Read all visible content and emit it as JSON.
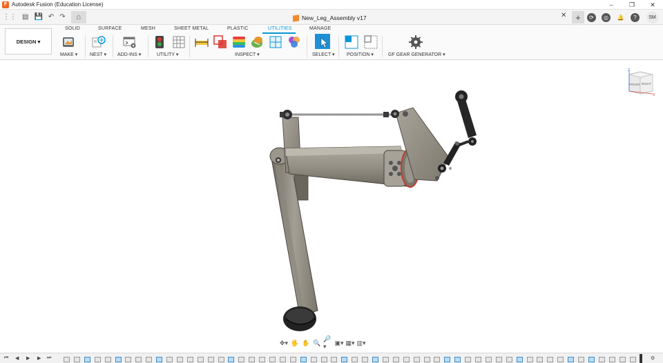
{
  "titlebar": {
    "logo_letter": "F",
    "title": "Autodesk Fusion (Education License)",
    "minimize": "–",
    "restore": "❐",
    "close": "✕"
  },
  "qat": {
    "grid_icon": "⋮⋮",
    "file_icon": "▤",
    "save_icon": "💾",
    "undo_icon": "↶",
    "redo_icon": "↷",
    "home_icon": "⌂"
  },
  "document": {
    "name": "New_Leg_Assembly v17",
    "close_icon": "✕",
    "new_tab_icon": "+"
  },
  "user": {
    "initials": "SM",
    "job_status_icon": "⟳",
    "extensions_icon": "◎",
    "notifications_icon": "🔔",
    "help_icon": "?"
  },
  "ribbon": {
    "workspace": "DESIGN ▾",
    "tabs": [
      "SOLID",
      "SURFACE",
      "MESH",
      "SHEET METAL",
      "PLASTIC",
      "UTILITIES",
      "MANAGE"
    ],
    "active_tab": "UTILITIES",
    "groups": {
      "make": "MAKE ▾",
      "nest": "NEST ▾",
      "addins": "ADD-INS ▾",
      "utility": "UTILITY ▾",
      "inspect": "INSPECT ▾",
      "select": "SELECT ▾",
      "position": "POSITION ▾",
      "gear": "GF GEAR GENERATOR ▾"
    }
  },
  "viewcube": {
    "front": "FRONT",
    "right": "RIGHT",
    "axis_z": "Z",
    "axis_x": "X"
  },
  "navbar": {
    "items": [
      "✥▾",
      "🖐",
      "✋",
      "🔍",
      "🔎▾",
      "▣▾",
      "▦▾",
      "▥▾"
    ]
  },
  "timeline": {
    "first": "⏮",
    "prev": "◀",
    "play": "▶",
    "next": "▶",
    "last": "⏭",
    "settings_icon": "⚙"
  },
  "colors": {
    "accent": "#0696d7",
    "brand": "#f26522"
  }
}
